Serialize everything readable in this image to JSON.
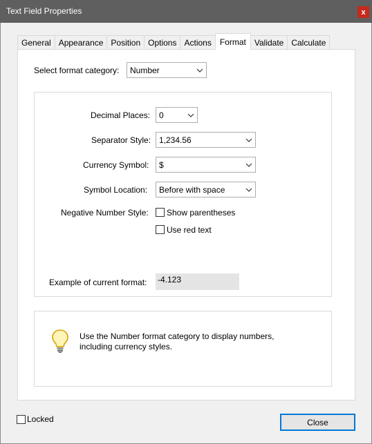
{
  "window": {
    "title": "Text Field Properties",
    "close_glyph": "x"
  },
  "tabs": [
    {
      "label": "General"
    },
    {
      "label": "Appearance"
    },
    {
      "label": "Position"
    },
    {
      "label": "Options"
    },
    {
      "label": "Actions"
    },
    {
      "label": "Format",
      "active": true
    },
    {
      "label": "Validate"
    },
    {
      "label": "Calculate"
    }
  ],
  "format": {
    "category_label": "Select format category:",
    "category_value": "Number",
    "decimal_label": "Decimal Places:",
    "decimal_value": "0",
    "separator_label": "Separator Style:",
    "separator_value": "1,234.56",
    "currency_label": "Currency Symbol:",
    "currency_value": "$",
    "location_label": "Symbol Location:",
    "location_value": "Before with space",
    "negative_label": "Negative Number Style:",
    "show_parentheses": "Show parentheses",
    "show_parentheses_checked": false,
    "use_red": "Use red text",
    "use_red_checked": false,
    "example_label": "Example of current format:",
    "example_value": "-4.123"
  },
  "hint": {
    "icon": "lightbulb-icon",
    "line1": "Use the Number format category to display numbers,",
    "line2": "including currency styles."
  },
  "footer": {
    "locked_label": "Locked",
    "locked_checked": false,
    "close_label": "Close"
  },
  "colors": {
    "titlebar": "#5f5f5f",
    "close_red": "#c42b1c",
    "focus_blue": "#0078d7"
  }
}
